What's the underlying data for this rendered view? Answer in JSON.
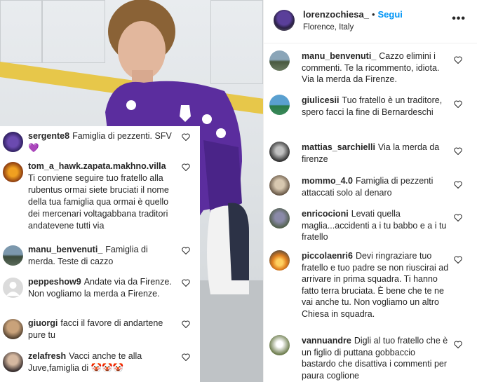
{
  "post": {
    "username": "lorenzochiesa_",
    "follow_label": "Segui",
    "location": "Florence, Italy",
    "more_label": "•••"
  },
  "left_comments": [
    {
      "user": "sergente8",
      "text": "Famiglia di pezzenti. SFV💜"
    },
    {
      "user": "tom_a_hawk.zapata.makhno.villa",
      "text": "Ti conviene seguire tuo fratello alla rubentus ormai siete bruciati il nome della tua famiglia qua ormai è quello dei mercenari voltagabbana traditori andatevene tutti via"
    },
    {
      "user": "manu_benvenuti_",
      "text": "Famiglia di merda. Teste di cazzo"
    },
    {
      "user": "peppeshow9",
      "text": "Andate via da Firenze. Non vogliamo la merda a Firenze."
    },
    {
      "user": "giuorgi",
      "text": "facci il favore di andartene pure tu"
    },
    {
      "user": "zelafresh",
      "text": "Vacci anche te alla Juve,famiglia di 🤡🤡🤡"
    }
  ],
  "right_comments": [
    {
      "user": "manu_benvenuti_",
      "text": "Cazzo elimini i commenti. Te la ricommento, idiota. Via la merda da Firenze."
    },
    {
      "user": "giulicesii",
      "text": "Tuo fratello è un traditore, spero facci la fine di Bernardeschi"
    },
    {
      "user": "mattias_sarchielli",
      "text": "Via la merda da firenze"
    },
    {
      "user": "mommo_4.0",
      "text": "Famiglia di pezzenti attaccati solo al denaro"
    },
    {
      "user": "enricocioni",
      "text": "Levati quella maglia...accidenti a i tu babbo e a i tu fratello"
    },
    {
      "user": "piccolaenri6",
      "text": "Devi ringraziare tuo fratello e tuo padre se non riuscirai ad arrivare in prima squadra. Ti hanno fatto terra bruciata. È bene che te ne vai anche tu. Non vogliamo un altro Chiesa in squadra."
    },
    {
      "user": "vannuandre",
      "text": "Digli al tuo fratello che è un figlio di puttana gobbaccio bastardo che disattiva i commenti per paura coglione"
    }
  ],
  "colors": {
    "accent": "#0095f6",
    "shirt": "#5b2d9e",
    "stripe": "#e7c74a"
  }
}
